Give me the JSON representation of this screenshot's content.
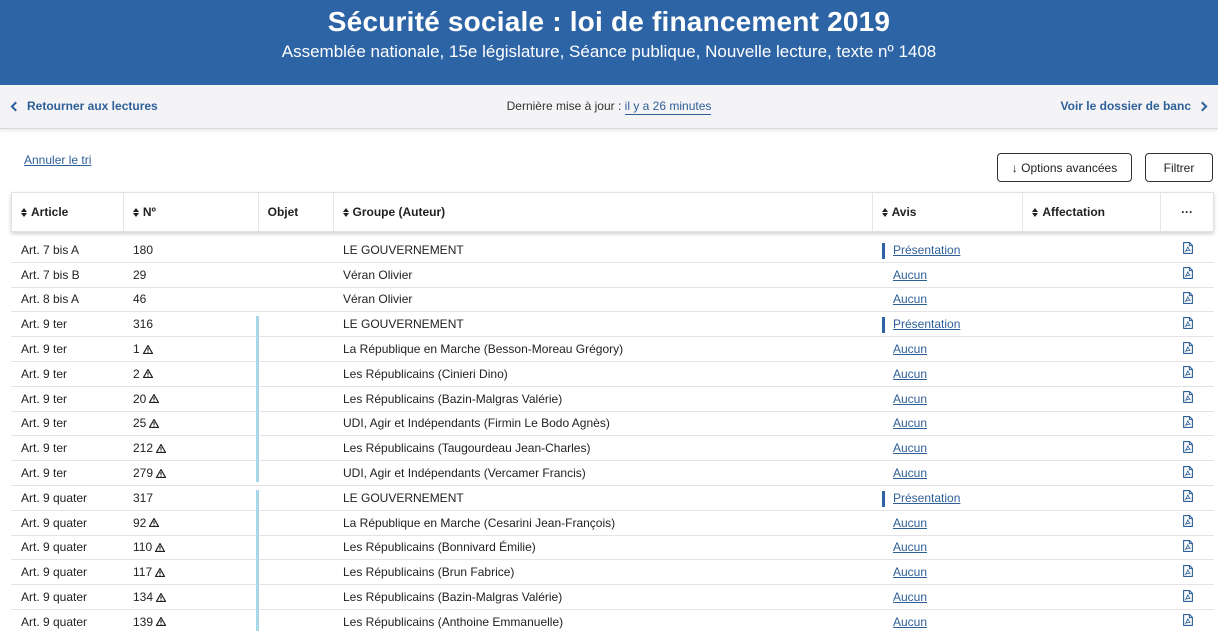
{
  "header": {
    "title": "Sécurité sociale : loi de financement 2019",
    "subtitle": "Assemblée nationale, 15e législature, Séance publique, Nouvelle lecture, texte nº 1408",
    "color": "#2d64a6"
  },
  "nav": {
    "back_label": "Retourner aux lectures",
    "update_prefix": "Dernière mise à jour :",
    "update_ago": "il y a 26 minutes",
    "next_label": "Voir le dossier de banc"
  },
  "toolbar": {
    "cancel_sort": "Annuler le tri",
    "options_label": "↓ Options avancées",
    "filter_label": "Filtrer"
  },
  "table": {
    "columns": {
      "article": "Article",
      "num": "Nº",
      "objet": "Objet",
      "groupe": "Groupe (Auteur)",
      "avis": "Avis",
      "affectation": "Affectation",
      "more": "···"
    },
    "rows": [
      {
        "article": "Art. 7 bis A",
        "num": "180",
        "warn": false,
        "groupe": "LE GOUVERNEMENT",
        "avis": "Présentation",
        "marker": true
      },
      {
        "article": "Art. 7 bis B",
        "num": "29",
        "warn": false,
        "groupe": "Véran Olivier",
        "avis": "Aucun",
        "marker": false
      },
      {
        "article": "Art. 8 bis A",
        "num": "46",
        "warn": false,
        "groupe": "Véran Olivier",
        "avis": "Aucun",
        "marker": false
      },
      {
        "article": "Art. 9 ter",
        "num": "316",
        "warn": false,
        "groupe": "LE GOUVERNEMENT",
        "avis": "Présentation",
        "marker": true
      },
      {
        "article": "Art. 9 ter",
        "num": "1",
        "warn": true,
        "groupe": "La République en Marche (Besson-Moreau Grégory)",
        "avis": "Aucun",
        "marker": false
      },
      {
        "article": "Art. 9 ter",
        "num": "2",
        "warn": true,
        "groupe": "Les Républicains (Cinieri Dino)",
        "avis": "Aucun",
        "marker": false
      },
      {
        "article": "Art. 9 ter",
        "num": "20",
        "warn": true,
        "groupe": "Les Républicains (Bazin-Malgras Valérie)",
        "avis": "Aucun",
        "marker": false
      },
      {
        "article": "Art. 9 ter",
        "num": "25",
        "warn": true,
        "groupe": "UDI, Agir et Indépendants (Firmin Le Bodo Agnès)",
        "avis": "Aucun",
        "marker": false
      },
      {
        "article": "Art. 9 ter",
        "num": "212",
        "warn": true,
        "groupe": "Les Républicains (Taugourdeau Jean-Charles)",
        "avis": "Aucun",
        "marker": false
      },
      {
        "article": "Art. 9 ter",
        "num": "279",
        "warn": true,
        "groupe": "UDI, Agir et Indépendants (Vercamer Francis)",
        "avis": "Aucun",
        "marker": false
      },
      {
        "article": "Art. 9 quater",
        "num": "317",
        "warn": false,
        "groupe": "LE GOUVERNEMENT",
        "avis": "Présentation",
        "marker": true
      },
      {
        "article": "Art. 9 quater",
        "num": "92",
        "warn": true,
        "groupe": "La République en Marche (Cesarini Jean-François)",
        "avis": "Aucun",
        "marker": false
      },
      {
        "article": "Art. 9 quater",
        "num": "110",
        "warn": true,
        "groupe": "Les Républicains (Bonnivard Émilie)",
        "avis": "Aucun",
        "marker": false
      },
      {
        "article": "Art. 9 quater",
        "num": "117",
        "warn": true,
        "groupe": "Les Républicains (Brun Fabrice)",
        "avis": "Aucun",
        "marker": false
      },
      {
        "article": "Art. 9 quater",
        "num": "134",
        "warn": true,
        "groupe": "Les Républicains (Bazin-Malgras Valérie)",
        "avis": "Aucun",
        "marker": false
      },
      {
        "article": "Art. 9 quater",
        "num": "139",
        "warn": true,
        "groupe": "Les Républicains (Anthoine Emmanuelle)",
        "avis": "Aucun",
        "marker": false
      }
    ]
  },
  "colors": {
    "link": "#2d5f98",
    "group_bar": "#a8d8e8"
  }
}
